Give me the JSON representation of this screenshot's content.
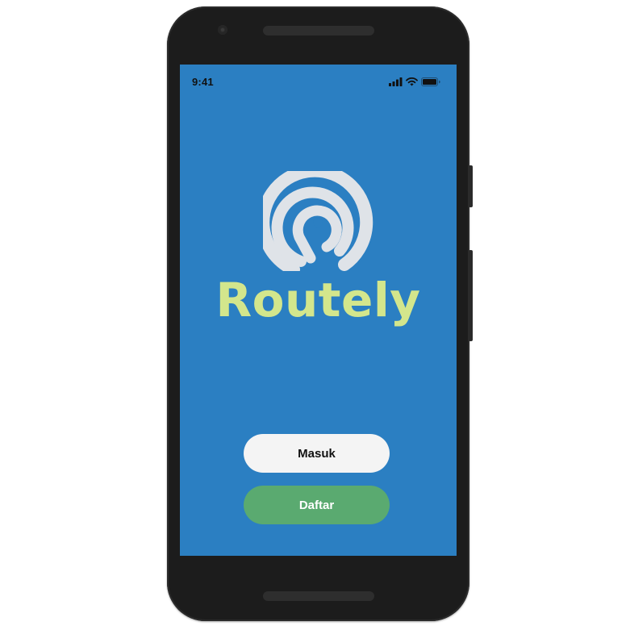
{
  "status_bar": {
    "time": "9:41",
    "icons": [
      "signal-icon",
      "wifi-icon",
      "battery-icon"
    ]
  },
  "app": {
    "name": "Routely",
    "logo_icon": "routely-logo-icon"
  },
  "actions": {
    "login_label": "Masuk",
    "register_label": "Daftar"
  },
  "colors": {
    "background": "#2b7fc2",
    "brand_text": "#d3e68c",
    "logo": "#dfe3e8",
    "login_button": "#f4f4f4",
    "register_button": "#5aaa70"
  }
}
